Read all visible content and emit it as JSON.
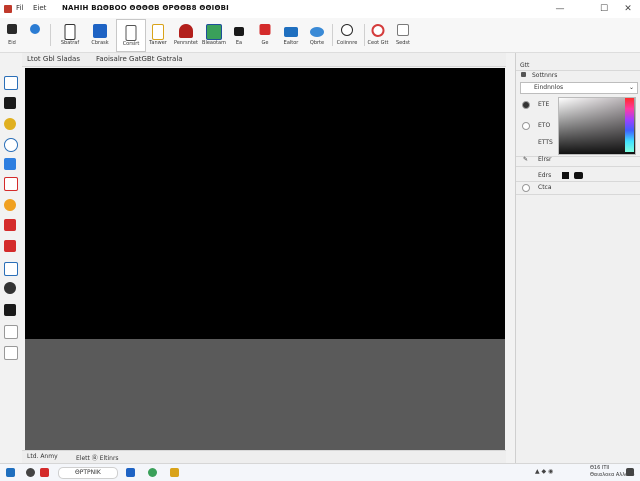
{
  "titlebar": {
    "menu": [
      "Fil",
      "Eiet"
    ],
    "title": "ΝΑΗΙΗ ΒΩΘΒΟΟ ΘΘΘΘΒ ΘΡΘΘΒ8 ΘΘΙΘΒΙ",
    "min": "—",
    "max": "☐",
    "close": "✕"
  },
  "toolbar": {
    "items": [
      {
        "label": "Eid",
        "color": "#2a2a2a"
      },
      {
        "label": "",
        "color": "#2b7cd3"
      },
      {
        "label": "Sbatraf",
        "color": "#ffffff"
      },
      {
        "label": "Cbrask",
        "color": "#1e63c4"
      },
      {
        "label": "Corsirt",
        "color": "#ffffff"
      },
      {
        "label": "Tanwer",
        "color": "#d9a31a"
      },
      {
        "label": "Penrsntet",
        "color": "#b3201c"
      },
      {
        "label": "Bleaotam",
        "color": "#3aa05a"
      },
      {
        "label": "Ea",
        "color": "#1a1a1a"
      },
      {
        "label": "Ge",
        "color": "#d42b2b"
      },
      {
        "label": "Ealtor",
        "color": "#1f6fbf"
      },
      {
        "label": "Qbrte",
        "color": "#3a8ad6"
      },
      {
        "label": "Coiinnre",
        "color": "#2a2a2a"
      },
      {
        "label": "Ceot Gtt",
        "color": "#d43b3b"
      },
      {
        "label": "Sedst",
        "color": "#7a7a7a"
      }
    ]
  },
  "left_tools": [
    "#2b6fb8",
    "#1a1a1a",
    "#e0b020",
    "#2b6fb8",
    "#2f7fe0",
    "#d42b2b",
    "#f0a020",
    "#d42b2b",
    "#d42b2b",
    "#2b6fb8",
    "#333333",
    "#1a1a1a",
    "#999999",
    "#999999"
  ],
  "canvas": {
    "header_left": "Ltot Gbl Sladas",
    "header_right": "Faoisalre GatGBt Gatrala",
    "footer_left": "Ltd. Anmy",
    "footer_right": "Elett Ⓑ Eltinrs"
  },
  "right_panel": {
    "header": "Gtt",
    "row1": "Sottnnrs",
    "dropdown": "Eindnnlos",
    "color_labels": [
      "ETE",
      "ETO",
      "ETTS"
    ],
    "row_b": "Elrsr",
    "row_c": "Edrs",
    "checkbox_label": "Ctca"
  },
  "taskbar": {
    "search_label": "ΘΡΤΡΝΙΚ",
    "clock_time": "Θ16 ΙΤΙΙ",
    "clock_date": "Θαιαλοεα Αλλαλο"
  }
}
